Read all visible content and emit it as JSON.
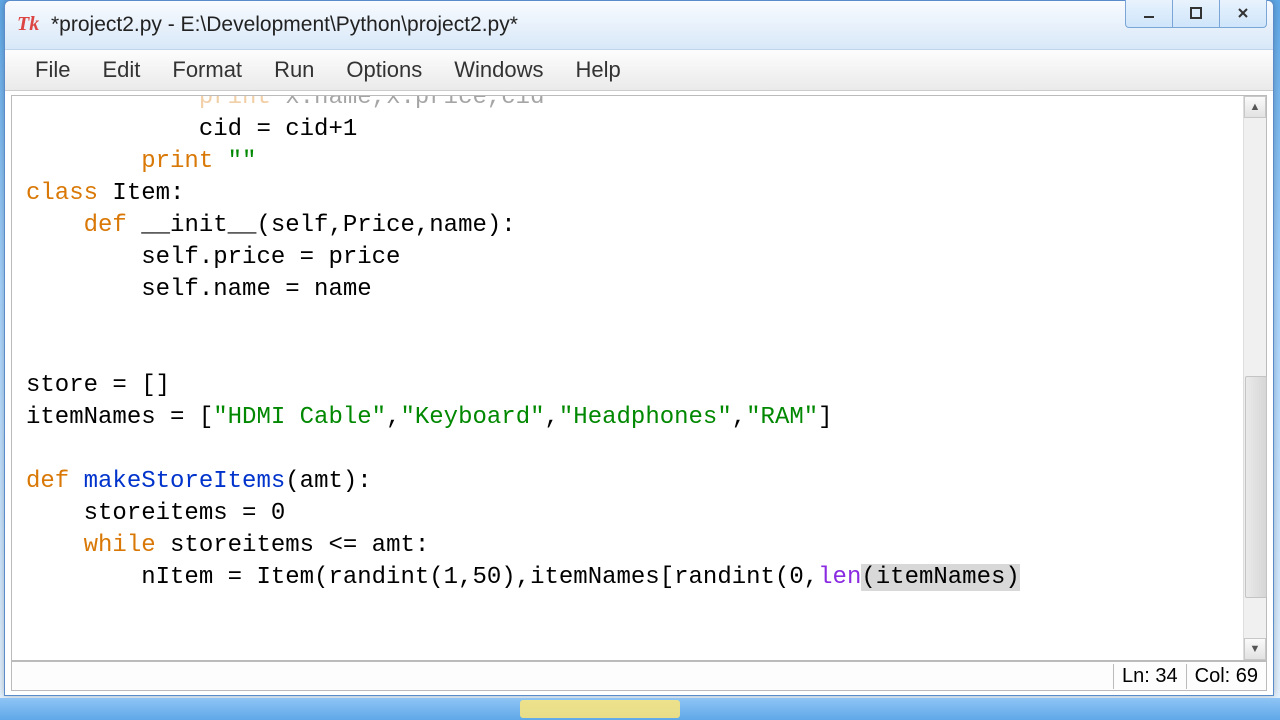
{
  "window": {
    "icon_text": "Tk",
    "title": "*project2.py - E:\\Development\\Python\\project2.py*"
  },
  "menu": {
    "file": "File",
    "edit": "Edit",
    "format": "Format",
    "run": "Run",
    "options": "Options",
    "windows": "Windows",
    "help": "Help"
  },
  "status": {
    "line": "Ln: 34",
    "col": "Col: 69"
  },
  "code": {
    "l0_a": "            ",
    "l0_b": "print",
    "l0_c": " x.name,x.price,cid",
    "l1": "            cid = cid+1",
    "l2_a": "        ",
    "l2_b": "print",
    "l2_c": " ",
    "l2_d": "\"\"",
    "l3_a": "class",
    "l3_b": " Item:",
    "l4_a": "    ",
    "l4_b": "def",
    "l4_c": " __init__(self,Price,name):",
    "l5": "        self.price = price",
    "l6": "        self.name = name",
    "l9": "store = []",
    "l10_a": "itemNames = [",
    "l10_b": "\"HDMI Cable\"",
    "l10_c": ",",
    "l10_d": "\"Keyboard\"",
    "l10_e": ",",
    "l10_f": "\"Headphones\"",
    "l10_g": ",",
    "l10_h": "\"RAM\"",
    "l10_i": "]",
    "l12_a": "def",
    "l12_b": " ",
    "l12_c": "makeStoreItems",
    "l12_d": "(amt):",
    "l13": "    storeitems = 0",
    "l14_a": "    ",
    "l14_b": "while",
    "l14_c": " storeitems <= amt:",
    "l15_a": "        nItem = Item(randint(1,50),itemNames[randint(0,",
    "l15_b": "len",
    "l15_c": "(itemNames)"
  }
}
